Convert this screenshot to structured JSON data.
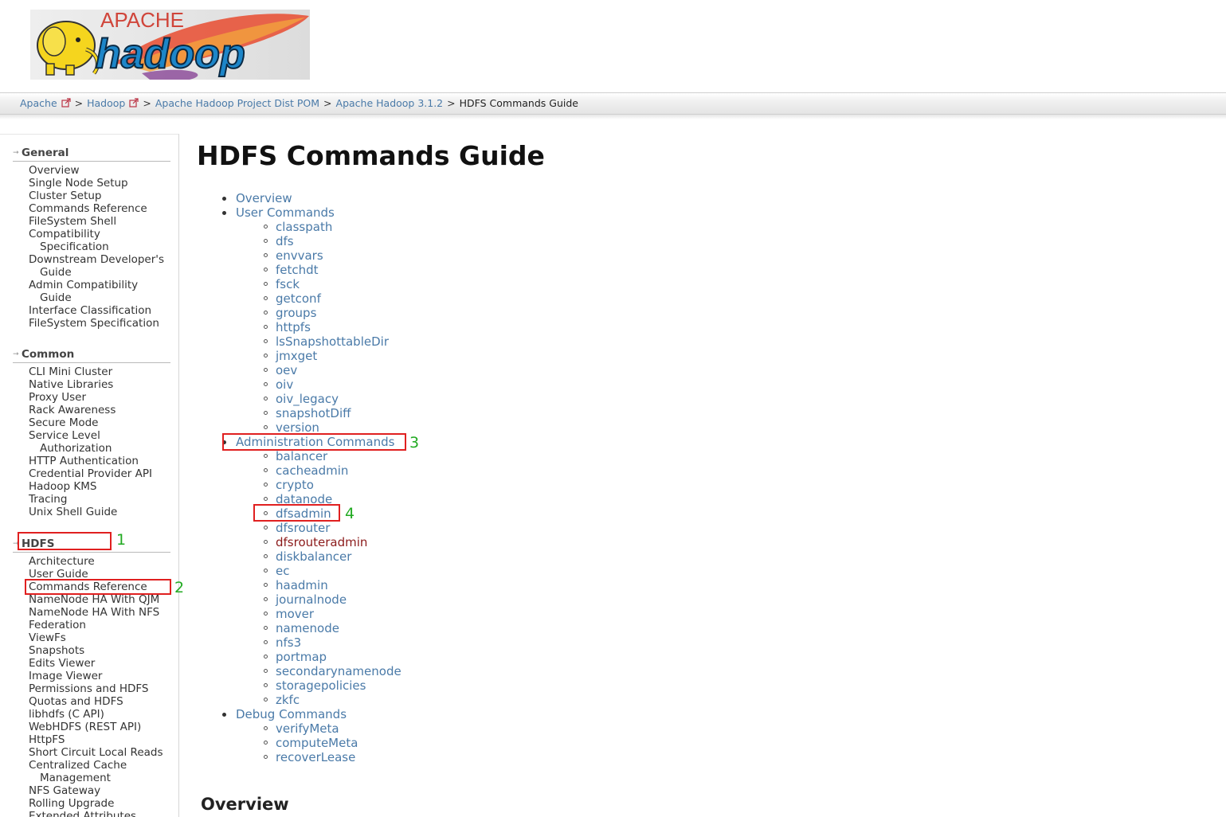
{
  "logo": {
    "apache_text": "APACHE",
    "hadoop_text": "hadoop"
  },
  "breadcrumbs": {
    "items": [
      {
        "label": "Apache",
        "external": true
      },
      {
        "label": "Hadoop",
        "external": true
      },
      {
        "label": "Apache Hadoop Project Dist POM",
        "external": false
      },
      {
        "label": "Apache Hadoop 3.1.2",
        "external": false
      }
    ],
    "current": "HDFS Commands Guide",
    "separator": ">"
  },
  "sidebar": {
    "sections": [
      {
        "title": "General",
        "items": [
          [
            "Overview"
          ],
          [
            "Single Node Setup"
          ],
          [
            "Cluster Setup"
          ],
          [
            "Commands Reference"
          ],
          [
            "FileSystem Shell"
          ],
          [
            "Compatibility",
            "Specification"
          ],
          [
            "Downstream Developer's",
            "Guide"
          ],
          [
            "Admin Compatibility",
            "Guide"
          ],
          [
            "Interface Classification"
          ],
          [
            "FileSystem Specification"
          ]
        ]
      },
      {
        "title": "Common",
        "items": [
          [
            "CLI Mini Cluster"
          ],
          [
            "Native Libraries"
          ],
          [
            "Proxy User"
          ],
          [
            "Rack Awareness"
          ],
          [
            "Secure Mode"
          ],
          [
            "Service Level",
            "Authorization"
          ],
          [
            "HTTP Authentication"
          ],
          [
            "Credential Provider API"
          ],
          [
            "Hadoop KMS"
          ],
          [
            "Tracing"
          ],
          [
            "Unix Shell Guide"
          ]
        ]
      },
      {
        "title": "HDFS",
        "items": [
          [
            "Architecture"
          ],
          [
            "User Guide"
          ],
          [
            "Commands Reference"
          ],
          [
            "NameNode HA With QJM"
          ],
          [
            "NameNode HA With NFS"
          ],
          [
            "Federation"
          ],
          [
            "ViewFs"
          ],
          [
            "Snapshots"
          ],
          [
            "Edits Viewer"
          ],
          [
            "Image Viewer"
          ],
          [
            "Permissions and HDFS"
          ],
          [
            "Quotas and HDFS"
          ],
          [
            "libhdfs (C API)"
          ],
          [
            "WebHDFS (REST API)"
          ],
          [
            "HttpFS"
          ],
          [
            "Short Circuit Local Reads"
          ],
          [
            "Centralized Cache",
            "Management"
          ],
          [
            "NFS Gateway"
          ],
          [
            "Rolling Upgrade"
          ],
          [
            "Extended Attributes"
          ]
        ]
      }
    ]
  },
  "main": {
    "title": "HDFS Commands Guide",
    "toc": [
      {
        "label": "Overview",
        "children": []
      },
      {
        "label": "User Commands",
        "children": [
          "classpath",
          "dfs",
          "envvars",
          "fetchdt",
          "fsck",
          "getconf",
          "groups",
          "httpfs",
          "lsSnapshottableDir",
          "jmxget",
          "oev",
          "oiv",
          "oiv_legacy",
          "snapshotDiff",
          "version"
        ]
      },
      {
        "label": "Administration Commands",
        "children": [
          "balancer",
          "cacheadmin",
          "crypto",
          "datanode",
          "dfsadmin",
          "dfsrouter",
          "dfsrouteradmin",
          "diskbalancer",
          "ec",
          "haadmin",
          "journalnode",
          "mover",
          "namenode",
          "nfs3",
          "portmap",
          "secondarynamenode",
          "storagepolicies",
          "zkfc"
        ]
      },
      {
        "label": "Debug Commands",
        "children": [
          "verifyMeta",
          "computeMeta",
          "recoverLease"
        ]
      }
    ],
    "visited_item": "dfsrouteradmin",
    "overview_heading": "Overview"
  },
  "annotations": [
    "1",
    "2",
    "3",
    "4"
  ],
  "colors": {
    "link": "#4a7aa8",
    "visited": "#8b1a1a",
    "annotation_box": "#e02020",
    "annotation_number": "#22aa22"
  }
}
